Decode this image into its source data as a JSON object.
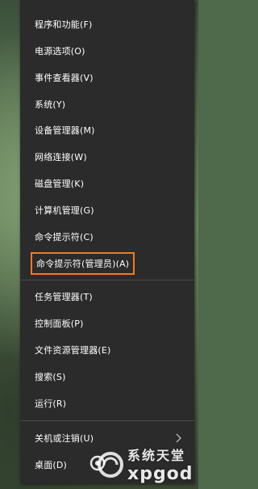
{
  "menu": {
    "items": [
      {
        "label": "程序和功能(F)"
      },
      {
        "label": "电源选项(O)"
      },
      {
        "label": "事件查看器(V)"
      },
      {
        "label": "系统(Y)"
      },
      {
        "label": "设备管理器(M)"
      },
      {
        "label": "网络连接(W)"
      },
      {
        "label": "磁盘管理(K)"
      },
      {
        "label": "计算机管理(G)"
      },
      {
        "label": "命令提示符(C)"
      },
      {
        "label": "命令提示符(管理员)(A)"
      },
      {
        "label": "任务管理器(T)"
      },
      {
        "label": "控制面板(P)"
      },
      {
        "label": "文件资源管理器(E)"
      },
      {
        "label": "搜索(S)"
      },
      {
        "label": "运行(R)"
      },
      {
        "label": "关机或注销(U)"
      },
      {
        "label": "桌面(D)"
      }
    ],
    "highlight_color": "#f07c22"
  },
  "watermark": {
    "text_cn": "系统天堂",
    "text_en": "xpgod"
  }
}
